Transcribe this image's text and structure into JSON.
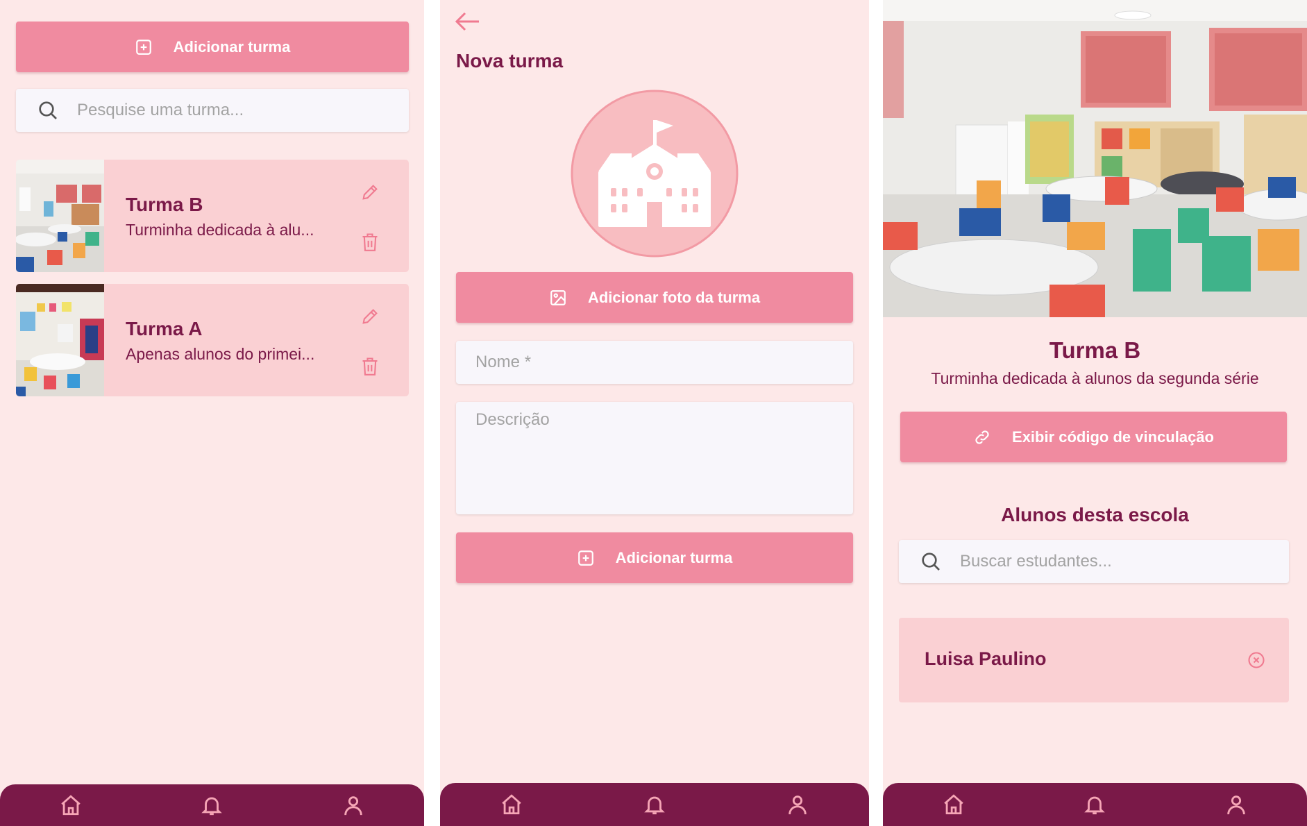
{
  "colors": {
    "accent": "#f08ba0",
    "dark": "#7a1948",
    "background": "#fde8e8",
    "card": "#fad0d3"
  },
  "screen_list": {
    "add_button_label": "Adicionar turma",
    "search_placeholder": "Pesquise uma turma...",
    "classes": [
      {
        "title": "Turma B",
        "description": "Turminha dedicada à alu..."
      },
      {
        "title": "Turma A",
        "description": "Apenas alunos do primei..."
      }
    ]
  },
  "screen_new": {
    "title": "Nova turma",
    "add_photo_label": "Adicionar foto da turma",
    "name_placeholder": "Nome *",
    "description_placeholder": "Descrição",
    "submit_label": "Adicionar turma"
  },
  "screen_detail": {
    "title": "Turma B",
    "subtitle": "Turminha dedicada à alunos da segunda série",
    "link_code_label": "Exibir código de vinculação",
    "students_heading": "Alunos desta escola",
    "search_placeholder": "Buscar estudantes...",
    "students": [
      {
        "name": "Luisa Paulino"
      }
    ]
  },
  "nav_icons": [
    "home-icon",
    "bell-icon",
    "profile-icon"
  ]
}
